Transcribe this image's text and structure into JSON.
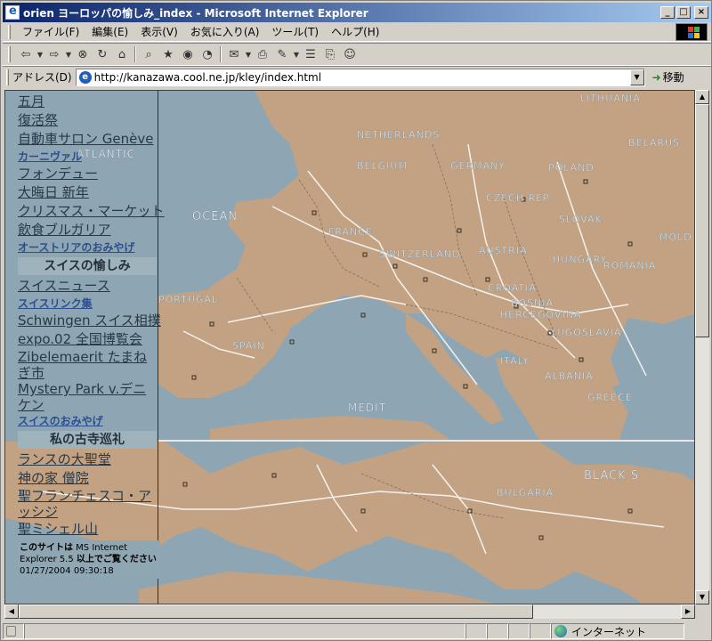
{
  "window": {
    "title": "orien ヨーロッパの愉しみ_index - Microsoft Internet Explorer"
  },
  "menu": [
    "ファイル(F)",
    "編集(E)",
    "表示(V)",
    "お気に入り(A)",
    "ツール(T)",
    "ヘルプ(H)"
  ],
  "address": {
    "label": "アドレス(D)",
    "url": "http://kanazawa.cool.ne.jp/kley/index.html",
    "go_label": "移動"
  },
  "sidebar": {
    "items_top": [
      {
        "label": "五月",
        "style": "normal"
      },
      {
        "label": "復活祭",
        "style": "normal"
      },
      {
        "label": "自動車サロン Genève",
        "style": "normal"
      },
      {
        "label": "カーニヴァル",
        "style": "small"
      },
      {
        "label": "フォンデュー",
        "style": "normal"
      },
      {
        "label": "大晦日 新年",
        "style": "normal"
      },
      {
        "label": "クリスマス・マーケット",
        "style": "normal"
      },
      {
        "label": "飲食ブルガリア",
        "style": "normal"
      },
      {
        "label": "オーストリアのおみやげ",
        "style": "small"
      }
    ],
    "section1": "スイスの愉しみ",
    "items_mid": [
      {
        "label": "スイスニュース",
        "style": "normal"
      },
      {
        "label": "スイスリンク集",
        "style": "small"
      },
      {
        "label": "Schwingen スイス相撲",
        "style": "normal"
      },
      {
        "label": "expo.02 全国博覧会",
        "style": "normal"
      },
      {
        "label": "Zibelemaerit たまねぎ市",
        "style": "wrap"
      },
      {
        "label": "Mystery Park v.デニケン",
        "style": "wrap"
      },
      {
        "label": "スイスのおみやげ",
        "style": "small"
      }
    ],
    "section2": "私の古寺巡礼",
    "items_bottom": [
      {
        "label": "ランスの大聖堂",
        "style": "normal"
      },
      {
        "label": "神の家 僧院",
        "style": "normal"
      },
      {
        "label": "聖フランチェスコ・アッシジ",
        "style": "wrap"
      },
      {
        "label": "聖ミシェル山",
        "style": "normal"
      }
    ],
    "notice_bold": "このサイトは",
    "notice_1": " MS Internet Explorer 5.5 ",
    "notice_bold2": "以上でご覧ください",
    "timestamp": "01/27/2004 09:30:18"
  },
  "map_labels": [
    "LITHUANIA",
    "BELARUS",
    "NETHERLANDS",
    "POLAND",
    "BELGIUM",
    "GERMANY",
    "CZECH REP.",
    "SLOVAK",
    "FRANCE",
    "AUSTRIA",
    "HUNGARY",
    "SWITZERLAND",
    "ROMANIA",
    "MOLD",
    "CROATIA",
    "BOSNIA",
    "HERCEGOVINA",
    "YUGOSLAVIA",
    "SPAIN",
    "PORTUGAL",
    "ITALY",
    "ALBANIA",
    "GREECE",
    "OCEAN",
    "ATLANTIC",
    "MEDIT",
    "BLACK S",
    "BULGARIA"
  ],
  "status": {
    "zone": "インターネット"
  },
  "colors": {
    "sea": "#8ea6b3",
    "land": "#c2a283",
    "title_gradient_start": "#0a246a",
    "title_gradient_end": "#a6caf0"
  }
}
